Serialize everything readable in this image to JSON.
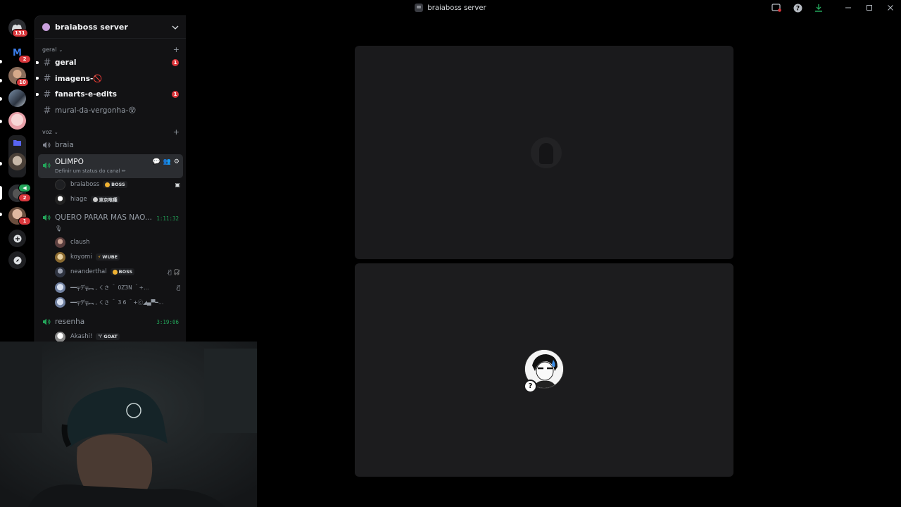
{
  "window": {
    "title": "braiaboss server"
  },
  "rail": {
    "home_badge": "131",
    "servers": [
      {
        "name": "M",
        "badge": "2",
        "color": "#0b3d91"
      },
      {
        "badge": "10",
        "color": "#8a6c5a"
      },
      {
        "badge": "",
        "color": "#4b5d73"
      },
      {
        "badge": "",
        "color": "#e8c0c0"
      },
      {
        "badge": "",
        "color": "#5865f2"
      },
      {
        "badge": "",
        "color": "#6b6157"
      },
      {
        "badge": "2",
        "color": "#3a3a3a"
      },
      {
        "badge": "1",
        "color": "#a07a60"
      }
    ],
    "add_server_label": "+",
    "explore_label": "explore"
  },
  "sidebar": {
    "server_name": "braiaboss server",
    "categories": {
      "text": "geral",
      "voice": "voz"
    },
    "text_channels": [
      {
        "name": "geral",
        "mention": "1",
        "unread": true
      },
      {
        "name": "imagens-🚫",
        "mention": "",
        "unread": true
      },
      {
        "name": "fanarts-e-edits",
        "mention": "1",
        "unread": true
      },
      {
        "name": "mural-da-vergonha-😵",
        "mention": "",
        "unread": false
      }
    ],
    "voice_channels": {
      "braia": "braia",
      "olimpo": {
        "name": "OLIMPO",
        "status": "Definir um status do canal ✏"
      },
      "olimpo_users": [
        {
          "name": "braiaboss",
          "tag": "BOSS"
        },
        {
          "name": "hiage",
          "tag": "東京喰種"
        }
      ],
      "quero": {
        "name": "QUERO PARAR MAS NAO...",
        "extra": "🎙",
        "timer": "1:11:32"
      },
      "quero_users": [
        {
          "name": "claush",
          "tag": ""
        },
        {
          "name": "koyomi",
          "tag": "WUBE"
        },
        {
          "name": "neanderthal",
          "tag": "BOSS"
        },
        {
          "name": "━━╤デ╦︻ , くさ ＾ 0Z3N  ＾+…",
          "tag": ""
        },
        {
          "name": "━━╤デ╦︻ , くさ ＾ 3 6 ＾+ⓒ◢▄▀━…",
          "tag": ""
        }
      ],
      "resenha": {
        "name": "resenha",
        "timer": "3:19:06"
      },
      "resenha_users": [
        {
          "name": "Akashi!",
          "tag": "GOAT"
        }
      ]
    }
  },
  "stage": {
    "participant_unknown": "?"
  },
  "colors": {
    "accent_green": "#23a55a",
    "mention_red": "#da373c",
    "blurple": "#5865f2"
  }
}
